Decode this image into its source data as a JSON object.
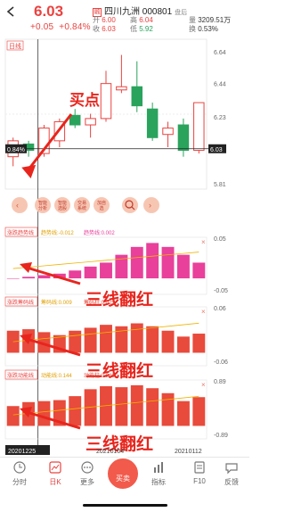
{
  "header": {
    "price": "6.03",
    "change": "+0.05",
    "change_pct": "+0.84%",
    "stock_name": "四川九洲 000801",
    "stock_tag": "融",
    "status": "盘后",
    "quotes": {
      "open_label": "开",
      "open_value": "6.00",
      "prev_label": "收",
      "prev_value": "6.03",
      "high_label": "高",
      "high_value": "6.04",
      "low_label": "低",
      "low_value": "5.92",
      "vol_label": "量",
      "vol_value": "3209.51万",
      "turnover_label": "换",
      "turnover_value": "0.53%"
    }
  },
  "kchart": {
    "period_label": "日线",
    "y_ticks": [
      "6.64",
      "6.44",
      "6.23",
      "6.03",
      "5.81"
    ],
    "cursor_y_label": "6.03",
    "cursor_pct_label": "0.84%",
    "annotation": "买点",
    "tool_buttons": [
      "智能分析",
      "智能选股",
      "交易系统",
      "加自选"
    ]
  },
  "panels": [
    {
      "name": "涨跌趋势线",
      "line1_label": "趋势线:-0.012",
      "line2_label": "趋势线:0.002",
      "y_top": "0.05",
      "y_bottom": "-0.05",
      "annotation": "三线翻红"
    },
    {
      "name": "涨跌筹码线",
      "line1_label": "筹码线:0.009",
      "line2_label": "筹码柱:0.025",
      "y_top": "0.06",
      "y_bottom": "-0.06",
      "annotation": "三线翻红"
    },
    {
      "name": "涨跌动能线",
      "line1_label": "动能线:0.144",
      "line2_label": "动能柱:0.246",
      "y_top": "0.89",
      "y_bottom": "-0.89",
      "annotation": "三线翻红"
    }
  ],
  "dates": [
    "20201225",
    "20210104",
    "20210112"
  ],
  "nav": {
    "items": [
      "分时",
      "日K",
      "更多",
      "买卖",
      "指标",
      "F10",
      "反馈"
    ],
    "active": "日K"
  },
  "colors": {
    "up": "#e94340",
    "down": "#2aa35d",
    "magenta": "#e8409b",
    "annotation": "#e8251d"
  },
  "chart_data": {
    "type": "candlestick",
    "candles": [
      {
        "o": 5.98,
        "c": 6.08,
        "h": 6.1,
        "l": 5.92
      },
      {
        "o": 6.06,
        "c": 6.02,
        "h": 6.08,
        "l": 5.98
      },
      {
        "o": 6.0,
        "c": 6.16,
        "h": 6.18,
        "l": 5.98
      },
      {
        "o": 6.08,
        "c": 6.2,
        "h": 6.22,
        "l": 6.04
      },
      {
        "o": 6.24,
        "c": 6.18,
        "h": 6.28,
        "l": 6.16
      },
      {
        "o": 6.18,
        "c": 6.22,
        "h": 6.25,
        "l": 6.1
      },
      {
        "o": 6.22,
        "c": 6.44,
        "h": 6.52,
        "l": 6.2
      },
      {
        "o": 6.4,
        "c": 6.42,
        "h": 6.62,
        "l": 6.38
      },
      {
        "o": 6.42,
        "c": 6.3,
        "h": 6.58,
        "l": 6.26
      },
      {
        "o": 6.28,
        "c": 6.1,
        "h": 6.32,
        "l": 6.08
      },
      {
        "o": 6.12,
        "c": 6.16,
        "h": 6.2,
        "l": 6.04
      },
      {
        "o": 6.18,
        "c": 6.02,
        "h": 6.22,
        "l": 5.98
      },
      {
        "o": 6.02,
        "c": 6.32,
        "h": 6.32,
        "l": 6.0
      }
    ],
    "panel1_bars": [
      0.0,
      0.002,
      0.004,
      0.006,
      0.01,
      0.015,
      0.02,
      0.03,
      0.04,
      0.045,
      0.04,
      0.03,
      0.02
    ],
    "panel2_bars": [
      0.03,
      0.032,
      0.028,
      0.024,
      0.03,
      0.034,
      0.038,
      0.036,
      0.04,
      0.036,
      0.03,
      0.022,
      0.026
    ],
    "panel3_bars": [
      0.4,
      0.48,
      0.5,
      0.52,
      0.6,
      0.74,
      0.8,
      0.78,
      0.82,
      0.76,
      0.66,
      0.5,
      0.58
    ]
  }
}
